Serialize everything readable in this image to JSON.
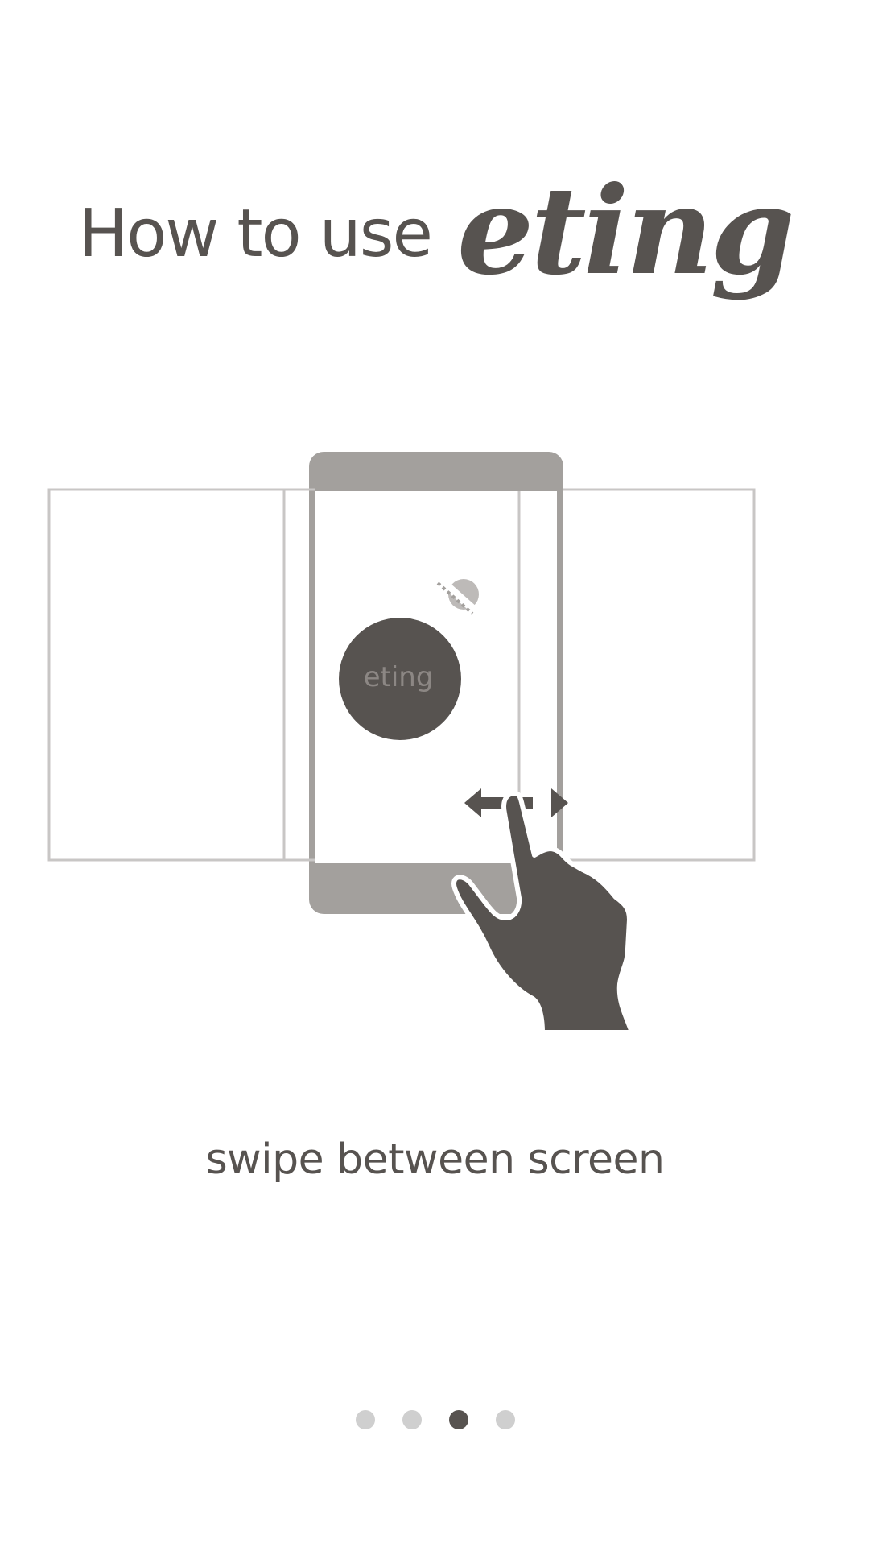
{
  "title": {
    "prefix": "How to use",
    "brand": "eting"
  },
  "illustration": {
    "badge_label": "eting"
  },
  "caption": "swipe between screen",
  "pager": {
    "total": 4,
    "active_index": 2
  },
  "colors": {
    "text": "#575350",
    "phone_frame": "#a3a09d",
    "panel_outline": "#c8c6c5",
    "dot_inactive": "#cfcfcf",
    "dot_active": "#575350",
    "badge_text": "#8c8784"
  }
}
